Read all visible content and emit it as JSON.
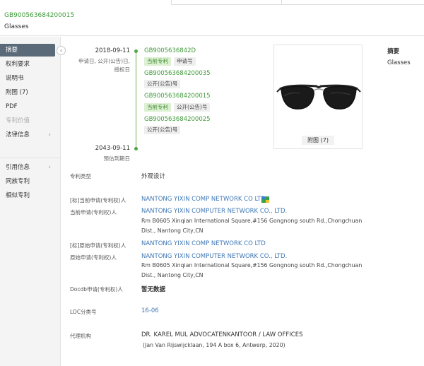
{
  "header": {
    "publication_number": "GB900563684200015",
    "title": "Glasses"
  },
  "sidebar": {
    "items": [
      {
        "label": "摘要",
        "state": "active"
      },
      {
        "label": "权利要求"
      },
      {
        "label": "说明书"
      },
      {
        "label": "附图 (7)"
      },
      {
        "label": "PDF"
      },
      {
        "label": "专利价值",
        "state": "disabled"
      },
      {
        "label": "法律信息",
        "chevron": "chevron-right-icon"
      },
      {
        "label": "引用信息",
        "chevron": "chevron-right-icon"
      },
      {
        "label": "同族专利"
      },
      {
        "label": "相似专利"
      }
    ],
    "collapse_icon": "chevron-left-icon"
  },
  "timeline": {
    "start_date": "2018-09-11",
    "start_desc": "申请日, 公开(公告)日, 授权日",
    "end_date": "2043-09-11",
    "end_desc": "预估到期日",
    "entries": [
      {
        "number": "GB9005636842D",
        "tags": [
          "当前专利",
          "申请号"
        ]
      },
      {
        "number": "GB900563684200035",
        "tags": [
          "公开(公告)号"
        ]
      },
      {
        "number": "GB900563684200015",
        "tags": [
          "当前专利",
          "公开(公告)号"
        ]
      },
      {
        "number": "GB900563684200025",
        "tags": [
          "公开(公告)号"
        ]
      }
    ]
  },
  "figure": {
    "button_label": "附图 (7)"
  },
  "abstract": {
    "title": "摘要",
    "text": "Glasses"
  },
  "fields": {
    "patent_type_label": "专利类型",
    "patent_type_value": "外观设计",
    "std_applicant_label": "[标]当前申请(专利权)人",
    "std_applicant_value": "NANTONG YIXIN COMP NETWORK CO LTD",
    "cur_applicant_label": "当前申请(专利权)人",
    "cur_applicant_value": "NANTONG YIXIN COMPUTER NETWORK CO., LTD.",
    "cur_applicant_addr": "Rm B0605 Xinqian International Square,#156 Gongnong south Rd.,Chongchuan Dist., Nantong City,CN",
    "std_orig_label": "[标]原始申请(专利权)人",
    "std_orig_value": "NANTONG YIXIN COMP NETWORK CO LTD",
    "orig_applicant_label": "原始申请(专利权)人",
    "orig_applicant_value": "NANTONG YIXIN COMPUTER NETWORK CO., LTD.",
    "orig_applicant_addr": "Rm B0605 Xinqian International Square,#156 Gongnong south Rd.,Chongchuan Dist., Nantong City,CN",
    "docdb_label": "Docdb申请(专利权)人",
    "docdb_value": "暂无数据",
    "loc_label": "LOC分类号",
    "loc_value": "16-06",
    "agency_label": "代理机构",
    "agency_value": "DR. KAREL MUL ADVOCATENKANTOOR / LAW OFFICES",
    "agency_addr": "(Jan Van Rijswijcklaan, 194 A box 6, Antwerp, 2020)"
  }
}
